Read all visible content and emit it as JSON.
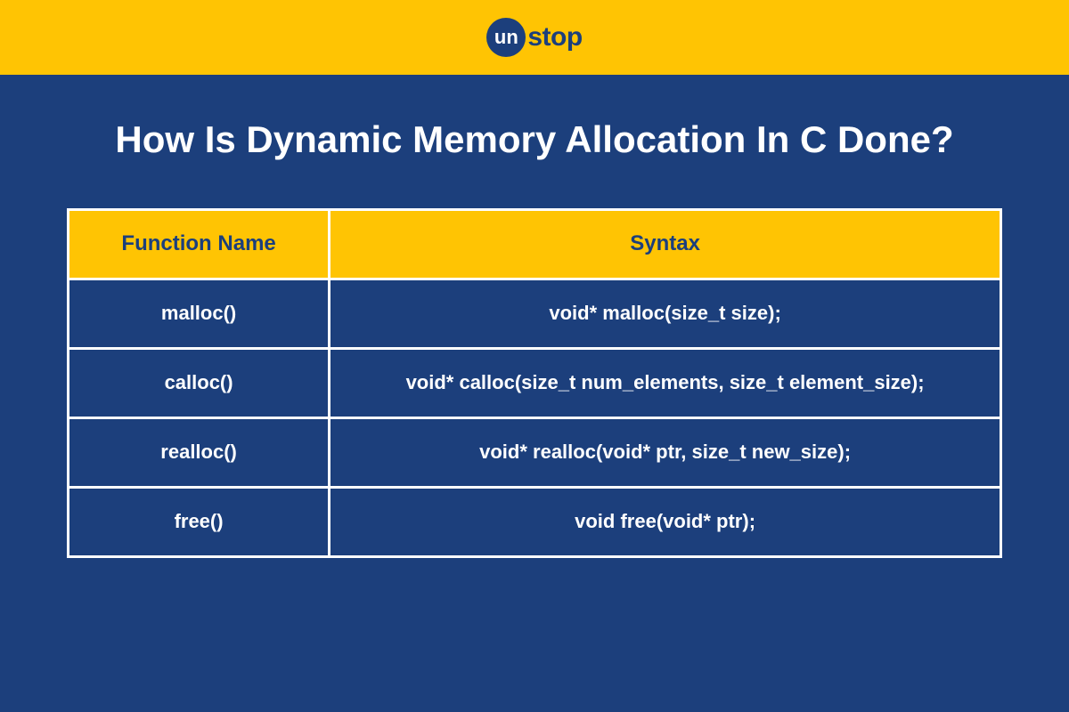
{
  "logo": {
    "circle_text": "un",
    "text": "stop"
  },
  "title": "How Is Dynamic Memory Allocation In C Done?",
  "table": {
    "headers": {
      "col1": "Function Name",
      "col2": "Syntax"
    },
    "rows": [
      {
        "name": "malloc()",
        "syntax": "void* malloc(size_t size);"
      },
      {
        "name": "calloc()",
        "syntax": "void* calloc(size_t num_elements, size_t element_size);"
      },
      {
        "name": "realloc()",
        "syntax": "void* realloc(void* ptr, size_t new_size);"
      },
      {
        "name": "free()",
        "syntax": "void free(void* ptr);"
      }
    ]
  }
}
